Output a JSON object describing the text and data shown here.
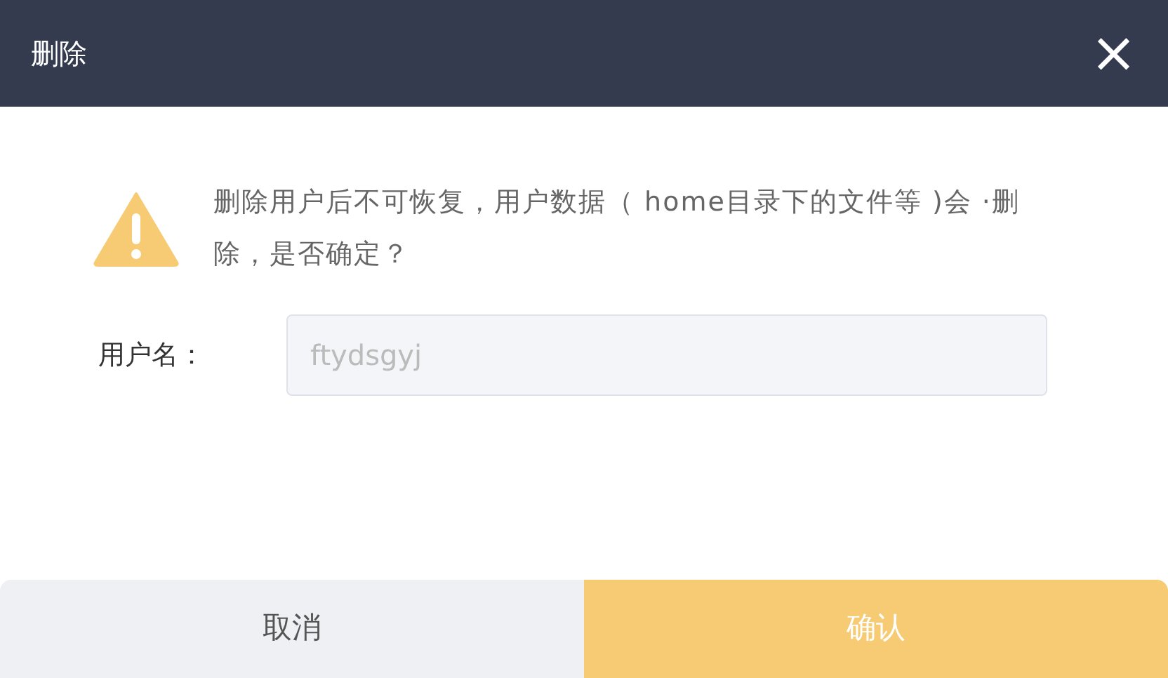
{
  "dialog": {
    "title": "删除",
    "close": "×"
  },
  "message": "删除用户后不可恢复，用户数据（ home目录下的文件等 )会 ·删除，是否确定？",
  "username": {
    "label": "用户名：",
    "value": "ftydsgyj",
    "disabled": true
  },
  "buttons": [
    {
      "label": "取消",
      "kind": "cancel"
    },
    {
      "label": "确认",
      "kind": "confirm"
    }
  ]
}
